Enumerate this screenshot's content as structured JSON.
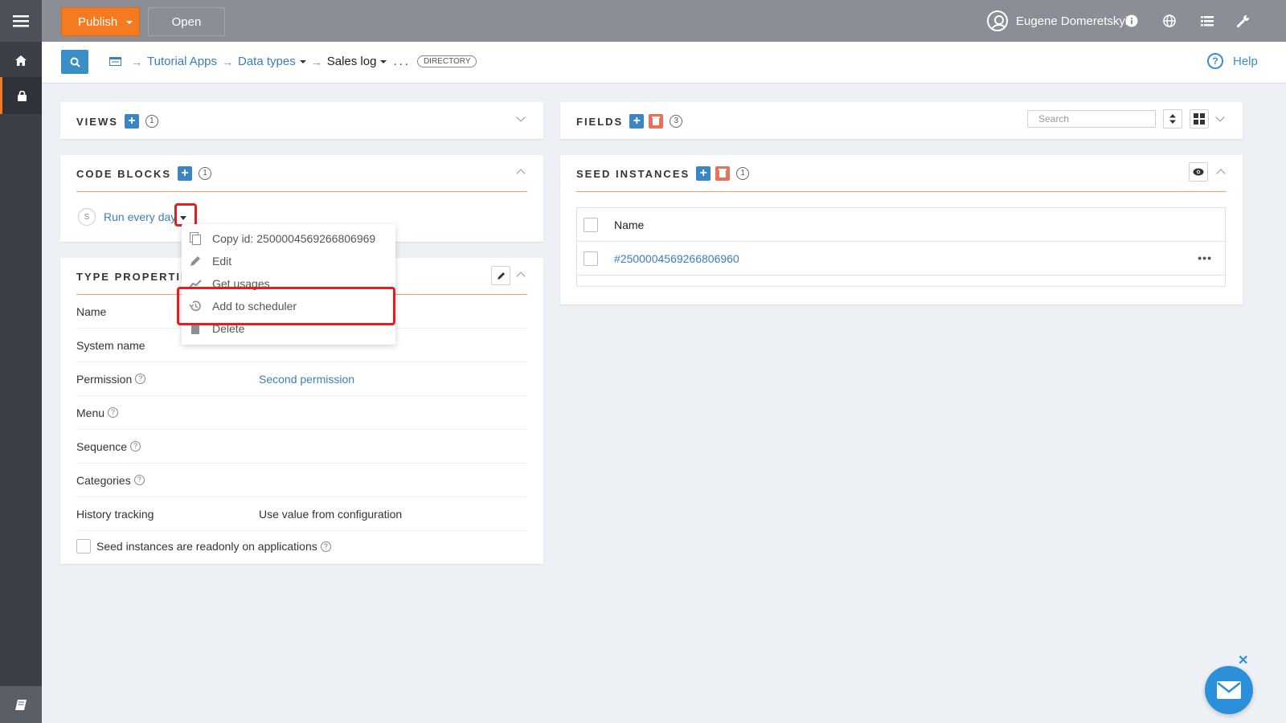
{
  "topbar": {
    "publish_label": "Publish",
    "open_label": "Open",
    "user_name": "Eugene Domeretskyi"
  },
  "breadcrumb": {
    "items": [
      "Tutorial Apps",
      "Data types",
      "Sales log"
    ],
    "dots": "...",
    "tag": "DIRECTORY"
  },
  "help_label": "Help",
  "views": {
    "title": "VIEWS",
    "count": "1"
  },
  "code_blocks": {
    "title": "CODE BLOCKS",
    "count": "1",
    "item_badge": "S",
    "item_label": "Run every day"
  },
  "context_menu": {
    "items": [
      {
        "label": "Copy id: 2500004569266806969",
        "icon": "copy-icon"
      },
      {
        "label": "Edit",
        "icon": "pencil-icon"
      },
      {
        "label": "Get usages",
        "icon": "chart-icon"
      },
      {
        "label": "Add to scheduler",
        "icon": "history-icon"
      },
      {
        "label": "Delete",
        "icon": "trash-icon"
      }
    ]
  },
  "type_properties": {
    "title": "TYPE PROPERTIES",
    "rows": [
      {
        "label": "Name",
        "value": "",
        "help": false
      },
      {
        "label": "System name",
        "value": "",
        "help": false
      },
      {
        "label": "Permission",
        "value": "Second permission",
        "help": true
      },
      {
        "label": "Menu",
        "value": "",
        "help": true
      },
      {
        "label": "Sequence",
        "value": "",
        "help": true
      },
      {
        "label": "Categories",
        "value": "",
        "help": true
      },
      {
        "label": "History tracking",
        "value": "Use value from configuration",
        "help": false
      }
    ],
    "checkbox_label": "Seed instances are readonly on applications"
  },
  "fields": {
    "title": "FIELDS",
    "count": "3",
    "search_placeholder": "Search"
  },
  "seed_instances": {
    "title": "SEED INSTANCES",
    "count": "1",
    "column_name": "Name",
    "rows": [
      "#2500004569266806960"
    ]
  },
  "colors": {
    "accent_orange": "#f47b20",
    "primary_blue": "#3a85c4",
    "highlight_red": "#e02020",
    "delete_red": "#e8715c"
  }
}
